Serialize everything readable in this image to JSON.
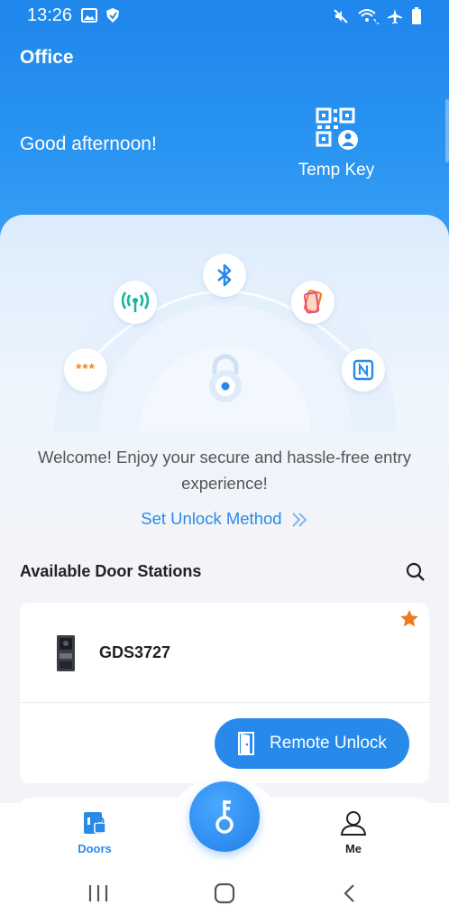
{
  "status_bar": {
    "time": "13:26",
    "left_icons": [
      "image-icon",
      "shield-icon"
    ],
    "right_icons": [
      "mute-icon",
      "wifi-call-icon",
      "airplane-icon",
      "battery-icon"
    ]
  },
  "header": {
    "site_name": "Office",
    "greeting": "Good afternoon!",
    "temp_key_label": "Temp Key",
    "temp_key_icon": "qr-person-icon"
  },
  "unlock_methods": [
    {
      "name": "bluetooth",
      "icon": "bluetooth-icon"
    },
    {
      "name": "nfc-signal",
      "icon": "signal-icon"
    },
    {
      "name": "shake-phone",
      "icon": "phone-shake-icon"
    },
    {
      "name": "password",
      "icon": "password-icon",
      "text": "***"
    },
    {
      "name": "nfc",
      "icon": "nfc-icon"
    }
  ],
  "welcome_text": "Welcome! Enjoy your secure and hassle-free entry experience!",
  "set_unlock_label": "Set Unlock Method",
  "section_title": "Available Door Stations",
  "door_stations": [
    {
      "name": "GDS3727",
      "favorite": true,
      "action_label": "Remote Unlock"
    }
  ],
  "tabs": [
    {
      "label": "Doors",
      "active": true,
      "icon": "door-lock-icon"
    },
    {
      "label": "Me",
      "active": false,
      "icon": "person-icon"
    }
  ],
  "fab_icon": "key-icon",
  "colors": {
    "primary": "#2789ea",
    "header_top": "#1f86ec",
    "accent_star": "#f07a1e",
    "signal_green": "#1bb39a"
  }
}
